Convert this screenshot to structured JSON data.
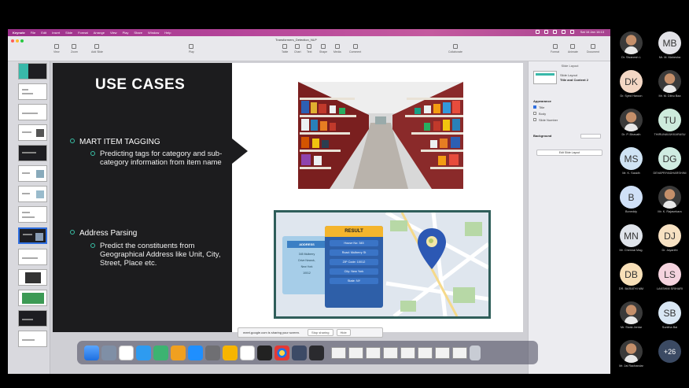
{
  "mac": {
    "menu": [
      "Keynote",
      "File",
      "Edit",
      "Insert",
      "Slide",
      "Format",
      "Arrange",
      "View",
      "Play",
      "Share",
      "Window",
      "Help"
    ],
    "clock": "Sat 16 Jan 16:13"
  },
  "keynote": {
    "doc_title": "Transformers_Detection_NLP",
    "toolbar": [
      "View",
      "Zoom",
      "Add Slide",
      "Play",
      "Table",
      "Chart",
      "Text",
      "Shape",
      "Media",
      "Comment",
      "Collaborate",
      "Format",
      "Animate",
      "Document"
    ]
  },
  "slide": {
    "title": "USE CASES",
    "bullet1": "MART ITEM TAGGING",
    "bullet1_sub": "Predicting tags for category and sub- category information from item name",
    "bullet2": "Address Parsing",
    "bullet2_sub": "Predict the constituents from Geographical Address like Unit, City, Street, Place etc.",
    "address": {
      "input_header": "ADDRESS",
      "input_lines": [
        "345 Mulberry",
        "Drive Nearok,",
        "New York",
        "10012"
      ],
      "result_header": "RESULT",
      "result_lines": [
        "House No: 345",
        "Road: Mulberry St",
        "ZIP Code: 10012",
        "City: New York",
        "State: NY"
      ]
    }
  },
  "inspector": {
    "tabs": [
      "Slide Layout"
    ],
    "layout_label": "Slide Layout",
    "layout_name": "Title and Content 2",
    "appearance": "Appearance",
    "opt_title": "Title",
    "opt_body": "Body",
    "opt_number": "Slide Number",
    "background": "Background",
    "edit_button": "Edit Slide Layout"
  },
  "share_banner": {
    "text": "meet.google.com is sharing your screen.",
    "stop": "Stop sharing",
    "hide": "Hide"
  },
  "participants": [
    {
      "initials": "",
      "name": "Dr. Sivanesh L",
      "color": "#ffffff",
      "photo": true
    },
    {
      "initials": "MB",
      "name": "Mr. M. Mahesha",
      "color": "#e3e3e8",
      "photo": false
    },
    {
      "initials": "DK",
      "name": "Dr. Syed Haroon",
      "color": "#f3d7c4",
      "photo": false
    },
    {
      "initials": "",
      "name": "Mr. M. Dilnu Baa",
      "color": "#ffffff",
      "photo": true
    },
    {
      "initials": "",
      "name": "Dr. P. Bhavath",
      "color": "#ffffff",
      "photo": true
    },
    {
      "initials": "TU",
      "name": "THIRUNAVUKKARASU",
      "color": "#cdebdc",
      "photo": false
    },
    {
      "initials": "MS",
      "name": "Mr. K. Sasidh",
      "color": "#cfe3f4",
      "photo": false
    },
    {
      "initials": "DG",
      "name": "DEVAPRIYADHARSHINI",
      "color": "#cfece1",
      "photo": false
    },
    {
      "initials": "B",
      "name": "Boneddy",
      "color": "#cfe0f7",
      "photo": false
    },
    {
      "initials": "",
      "name": "Mr. K. Rajasekara",
      "color": "#ffffff",
      "photo": true
    },
    {
      "initials": "MN",
      "name": "Mr. Chennai Mag.",
      "color": "#dfe3ea",
      "photo": false
    },
    {
      "initials": "DJ",
      "name": "Dr. Jayanthi",
      "color": "#f7e1c2",
      "photo": false
    },
    {
      "initials": "DB",
      "name": "DR. BARATHI MM",
      "color": "#f8e0b8",
      "photo": false
    },
    {
      "initials": "LS",
      "name": "LAKSHMI SRIHARI",
      "color": "#f4d3de",
      "photo": false
    },
    {
      "initials": "",
      "name": "Mr. Sivak Jentar",
      "color": "#ffffff",
      "photo": true
    },
    {
      "initials": "SB",
      "name": "Sunitha Bai",
      "color": "#d9e7f4",
      "photo": false
    },
    {
      "initials": "",
      "name": "Mr. Jai Rachandar",
      "color": "#ffffff",
      "photo": true
    },
    {
      "initials": "+26",
      "name": "",
      "color": "#3b4a63",
      "photo": false
    }
  ]
}
